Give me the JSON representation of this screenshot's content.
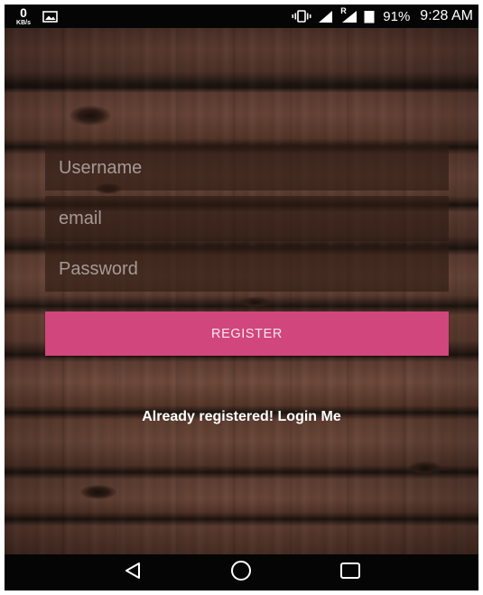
{
  "status_bar": {
    "net_speed_value": "0",
    "net_speed_unit": "KB/s",
    "battery_percent": "91%",
    "time": "9:28 AM",
    "roaming_indicator": "R",
    "icons": [
      "image-icon",
      "vibrate-icon",
      "signal-icon",
      "roaming-signal-icon",
      "battery-icon"
    ]
  },
  "form": {
    "username_placeholder": "Username",
    "email_placeholder": "email",
    "password_placeholder": "Password",
    "register_label": "REGISTER",
    "login_link": "Already registered! Login Me"
  },
  "nav_bar": {
    "icons": [
      "back-icon",
      "home-icon",
      "recents-icon"
    ]
  },
  "colors": {
    "accent": "#d1467c",
    "field_background": "#2d1b14",
    "status_bar": "#050505"
  }
}
